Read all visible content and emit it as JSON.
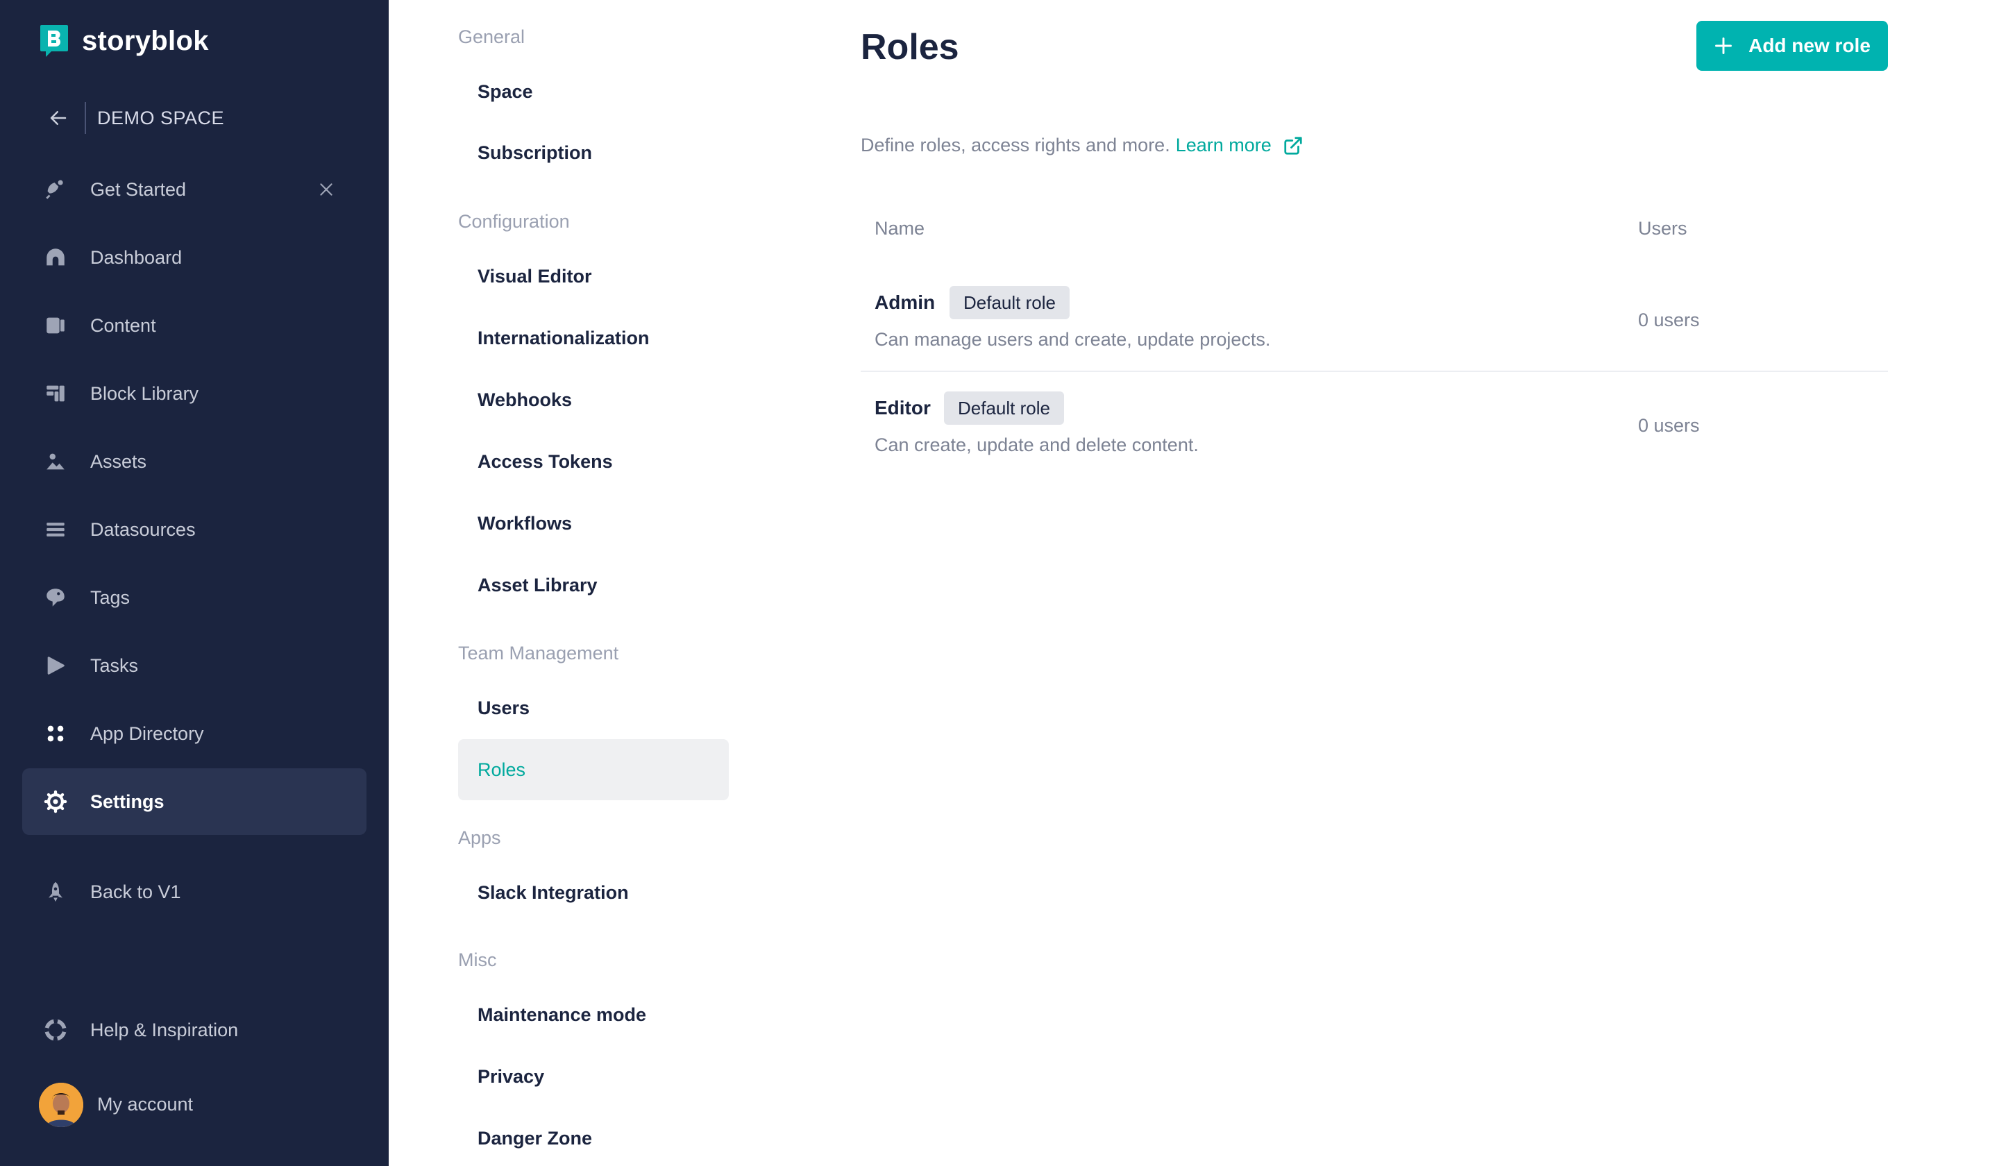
{
  "app": {
    "brand": "storyblok",
    "space_name": "DEMO SPACE",
    "accent_color": "#00b3b0",
    "sidebar_color": "#1b243f"
  },
  "sidebar": {
    "items": [
      {
        "label": "Get Started",
        "icon": "rocket-hand-icon"
      },
      {
        "label": "Dashboard",
        "icon": "dashboard-icon"
      },
      {
        "label": "Content",
        "icon": "content-icon"
      },
      {
        "label": "Block Library",
        "icon": "block-library-icon"
      },
      {
        "label": "Assets",
        "icon": "assets-icon"
      },
      {
        "label": "Datasources",
        "icon": "datasources-icon"
      },
      {
        "label": "Tags",
        "icon": "tag-icon"
      },
      {
        "label": "Tasks",
        "icon": "tasks-icon"
      },
      {
        "label": "App Directory",
        "icon": "app-directory-icon"
      },
      {
        "label": "Settings",
        "icon": "gear-icon",
        "active": true
      },
      {
        "label": "Back to V1",
        "icon": "rocket-icon"
      },
      {
        "label": "Help & Inspiration",
        "icon": "lifebuoy-icon"
      }
    ],
    "account_label": "My account"
  },
  "subnav": {
    "sections": [
      {
        "title": "General",
        "items": [
          "Space",
          "Subscription"
        ]
      },
      {
        "title": "Configuration",
        "items": [
          "Visual Editor",
          "Internationalization",
          "Webhooks",
          "Access Tokens",
          "Workflows",
          "Asset Library"
        ]
      },
      {
        "title": "Team Management",
        "items": [
          "Users",
          "Roles"
        ]
      },
      {
        "title": "Apps",
        "items": [
          "Slack Integration"
        ]
      },
      {
        "title": "Misc",
        "items": [
          "Maintenance mode",
          "Privacy",
          "Danger Zone"
        ]
      }
    ],
    "active_item": "Roles"
  },
  "main": {
    "title": "Roles",
    "add_button_label": "Add new role",
    "description": "Define roles, access rights and more.",
    "learn_more": "Learn more",
    "table": {
      "columns": [
        "Name",
        "Users"
      ],
      "rows": [
        {
          "name": "Admin",
          "badge": "Default role",
          "description": "Can manage users and create, update projects.",
          "users": "0 users"
        },
        {
          "name": "Editor",
          "badge": "Default role",
          "description": "Can create, update and delete content.",
          "users": "0 users"
        }
      ]
    }
  }
}
